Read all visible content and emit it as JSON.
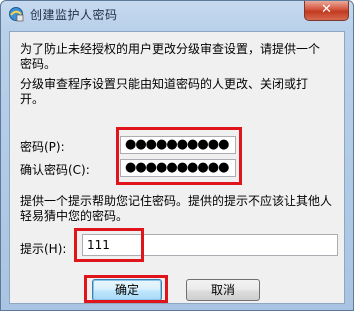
{
  "window": {
    "title": "创建监护人密码",
    "close_label": "✕"
  },
  "intro": {
    "line1": "为了防止未经授权的用户更改分级审查设置，请提供一个密码。",
    "line2": "分级审查程序设置只能由知道密码的人更改、关闭或打开。"
  },
  "password": {
    "label": "密码(P):",
    "value": "●●●●●●●●●●"
  },
  "confirm": {
    "label": "确认密码(C):",
    "value": "●●●●●●●●●●"
  },
  "hint_info": "提供一个提示帮助您记住密码。提供的提示不应该让其他人轻易猜中您的密码。",
  "hint": {
    "label": "提示(H):",
    "value": "111"
  },
  "buttons": {
    "ok": "确定",
    "cancel": "取消"
  },
  "colors": {
    "highlight": "#e0141b",
    "title_bar": "#b9d0ea",
    "client_bg": "#f0f0f0"
  },
  "icons": {
    "title": "internet-options-icon",
    "close": "close-icon"
  }
}
